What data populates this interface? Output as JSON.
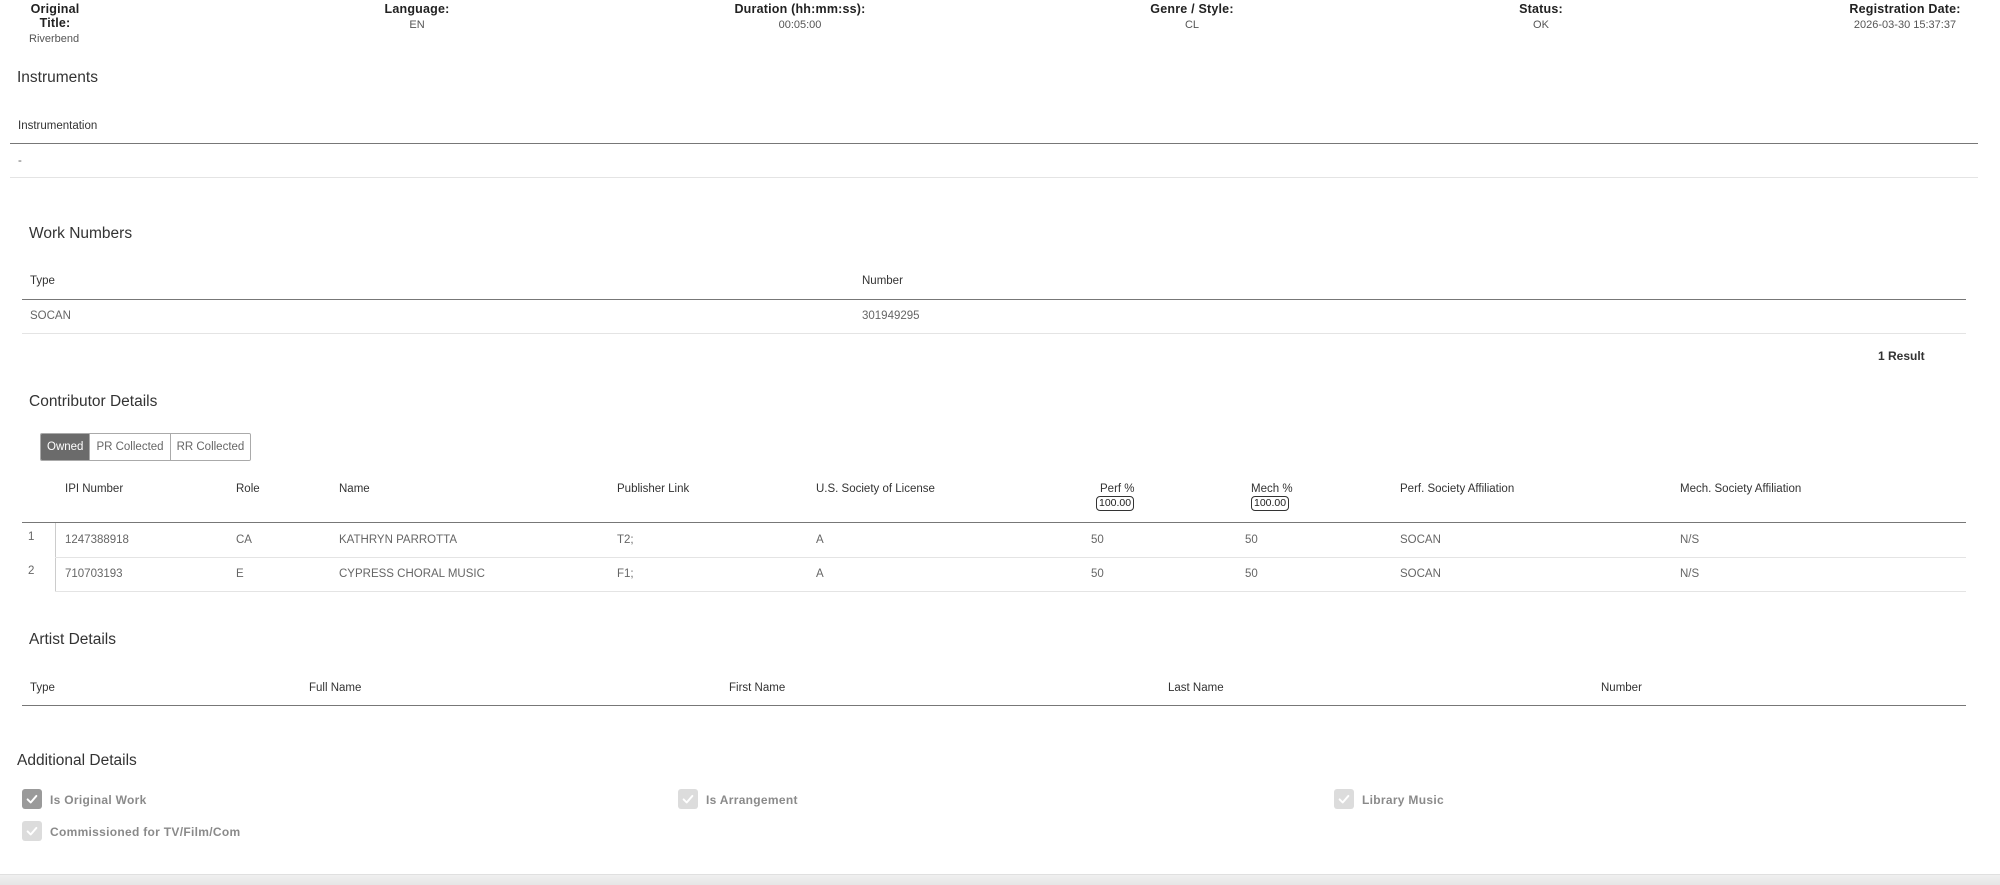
{
  "summary": [
    {
      "label": "Original Title:",
      "value": "Riverbend"
    },
    {
      "label": "Language:",
      "value": "EN"
    },
    {
      "label": "Duration (hh:mm:ss):",
      "value": "00:05:00"
    },
    {
      "label": "Genre / Style:",
      "value": "CL"
    },
    {
      "label": "Status:",
      "value": "OK"
    },
    {
      "label": "Registration Date:",
      "value": "2026-03-30 15:37:37"
    }
  ],
  "instruments": {
    "title": "Instruments",
    "header": "Instrumentation",
    "value": "-"
  },
  "work_numbers": {
    "title": "Work Numbers",
    "headers": {
      "type": "Type",
      "number": "Number"
    },
    "rows": [
      {
        "type": "SOCAN",
        "number": "301949295"
      }
    ],
    "result_count": "1 Result"
  },
  "contributors": {
    "title": "Contributor Details",
    "tabs": [
      "Owned",
      "PR Collected",
      "RR Collected"
    ],
    "active_tab": "Owned",
    "headers": {
      "ipi": "IPI Number",
      "role": "Role",
      "name": "Name",
      "publisher_link": "Publisher Link",
      "us_society": "U.S. Society of License",
      "perf": "Perf %",
      "mech": "Mech %",
      "perf_affil": "Perf. Society Affiliation",
      "mech_affil": "Mech. Society Affiliation"
    },
    "perf_total": "100.00",
    "mech_total": "100.00",
    "rows": [
      {
        "index": "1",
        "ipi": "1247388918",
        "role": "CA",
        "name": "KATHRYN PARROTTA",
        "publisher_link": "T2;",
        "us_society": "A",
        "perf": "50",
        "mech": "50",
        "perf_affil": "SOCAN",
        "mech_affil": "N/S"
      },
      {
        "index": "2",
        "ipi": "710703193",
        "role": "E",
        "name": "CYPRESS CHORAL MUSIC",
        "publisher_link": "F1;",
        "us_society": "A",
        "perf": "50",
        "mech": "50",
        "perf_affil": "SOCAN",
        "mech_affil": "N/S"
      }
    ]
  },
  "artists": {
    "title": "Artist Details",
    "headers": {
      "type": "Type",
      "full_name": "Full Name",
      "first_name": "First Name",
      "last_name": "Last Name",
      "number": "Number"
    }
  },
  "additional": {
    "title": "Additional Details",
    "items": [
      {
        "label": "Is Original Work",
        "checked": true
      },
      {
        "label": "Is Arrangement",
        "checked": false
      },
      {
        "label": "Library Music",
        "checked": false
      },
      {
        "label": "Commissioned for TV/Film/Com",
        "checked": false
      }
    ]
  },
  "colors": {
    "accent": "#6b6b6b",
    "checkbox_on": "#9a9a9a",
    "checkbox_off": "#dcdcdc"
  },
  "icons": {
    "checkbox": "check-icon"
  }
}
